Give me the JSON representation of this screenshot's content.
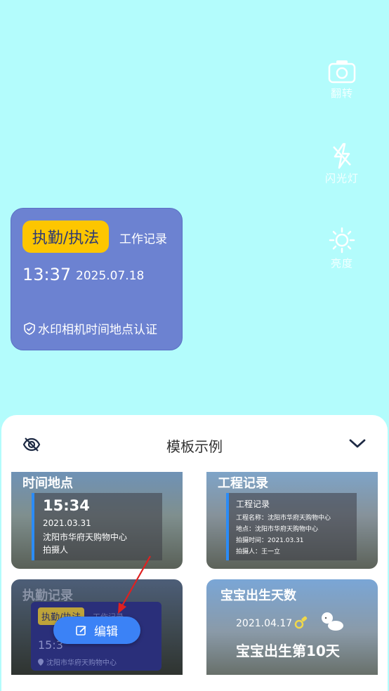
{
  "side_tools": [
    {
      "icon": "camera-flip-icon",
      "label": "翻转"
    },
    {
      "icon": "flash-off-icon",
      "label": "闪光灯"
    },
    {
      "icon": "brightness-icon",
      "label": "亮度"
    }
  ],
  "watermark": {
    "tag": "执勤/执法",
    "subtitle": "工作记录",
    "time": "13:37",
    "date": "2025.07.18",
    "certification": "水印相机时间地点认证",
    "colors": {
      "card": "#6c82d1",
      "tag": "#fdc600"
    }
  },
  "sheet": {
    "title": "模板示例",
    "templates": [
      {
        "title": "时间地点",
        "time": "15:34",
        "date": "2021.03.31",
        "place": "沈阳市华府天购物中心",
        "photographer": "拍摄人"
      },
      {
        "title": "工程记录",
        "heading": "工程记录",
        "lines": [
          "工程名称：沈阳市华府天购物中心",
          "地点：沈阳市华府天购物中心",
          "拍摄时间：2021.03.31",
          "拍摄人：王一立"
        ]
      },
      {
        "title": "执勤记录",
        "tag": "执勤/执法",
        "subtitle": "工作记录",
        "time": "15:3",
        "place": "沈阳市华府天购物中心"
      },
      {
        "title": "宝宝出生天数",
        "date": "2021.04.17",
        "caption": "宝宝出生第10天"
      }
    ],
    "edit_button": "编辑"
  }
}
